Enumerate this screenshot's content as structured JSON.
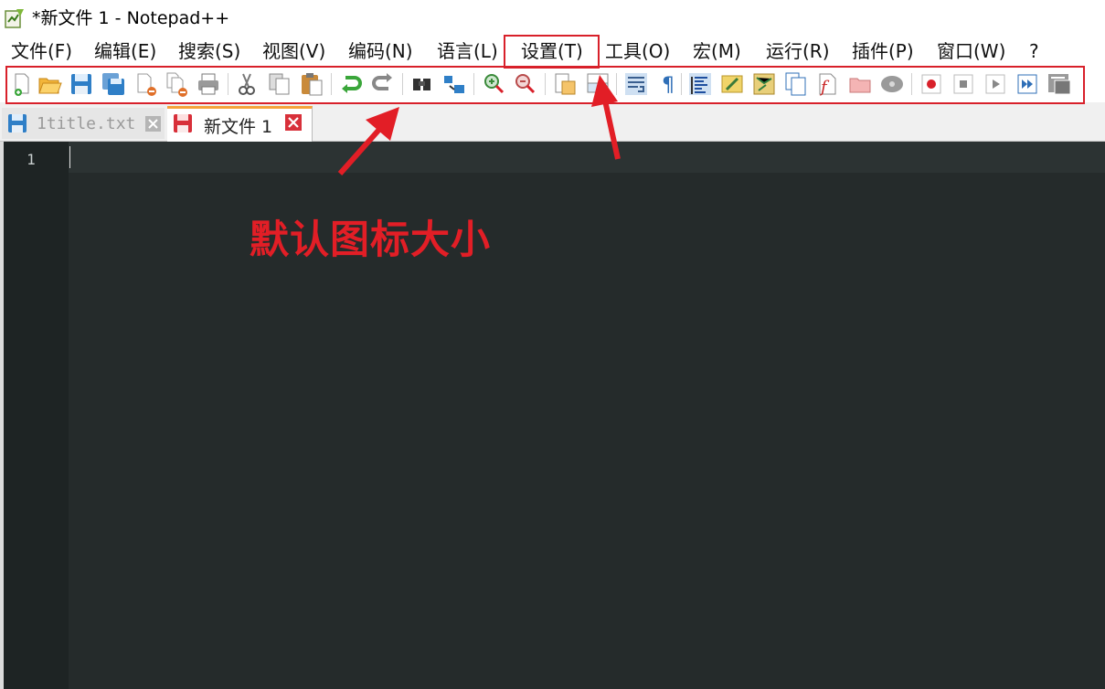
{
  "window": {
    "title": "*新文件 1 - Notepad++"
  },
  "menu": {
    "items": [
      {
        "label": "文件(F)"
      },
      {
        "label": "编辑(E)"
      },
      {
        "label": "搜索(S)"
      },
      {
        "label": "视图(V)"
      },
      {
        "label": "编码(N)"
      },
      {
        "label": "语言(L)"
      },
      {
        "label": "设置(T)"
      },
      {
        "label": "工具(O)"
      },
      {
        "label": "宏(M)"
      },
      {
        "label": "运行(R)"
      },
      {
        "label": "插件(P)"
      },
      {
        "label": "窗口(W)"
      },
      {
        "label": "?"
      }
    ]
  },
  "toolbar": {
    "icons": [
      "new-file-icon",
      "open-file-icon",
      "save-icon",
      "save-all-icon",
      "close-icon",
      "close-all-icon",
      "print-icon",
      "cut-icon",
      "copy-icon",
      "paste-icon",
      "undo-icon",
      "redo-icon",
      "find-icon",
      "replace-icon",
      "zoom-in-icon",
      "zoom-out-icon",
      "sync-vertical-icon",
      "sync-horizontal-icon",
      "word-wrap-icon",
      "show-all-chars-icon",
      "indent-guide-icon",
      "udl-icon",
      "doc-map-icon",
      "doc-list-icon",
      "function-list-icon",
      "folder-workspace-icon",
      "monitoring-icon",
      "record-macro-icon",
      "stop-record-icon",
      "playback-icon",
      "run-macro-multiple-icon",
      "save-macro-icon"
    ]
  },
  "tabs": [
    {
      "label": "1title.txt",
      "active": false
    },
    {
      "label": "新文件 1",
      "active": true
    }
  ],
  "editor": {
    "line_numbers": [
      "1"
    ]
  },
  "annotation": {
    "text": "默认图标大小",
    "color": "#e21e26"
  }
}
